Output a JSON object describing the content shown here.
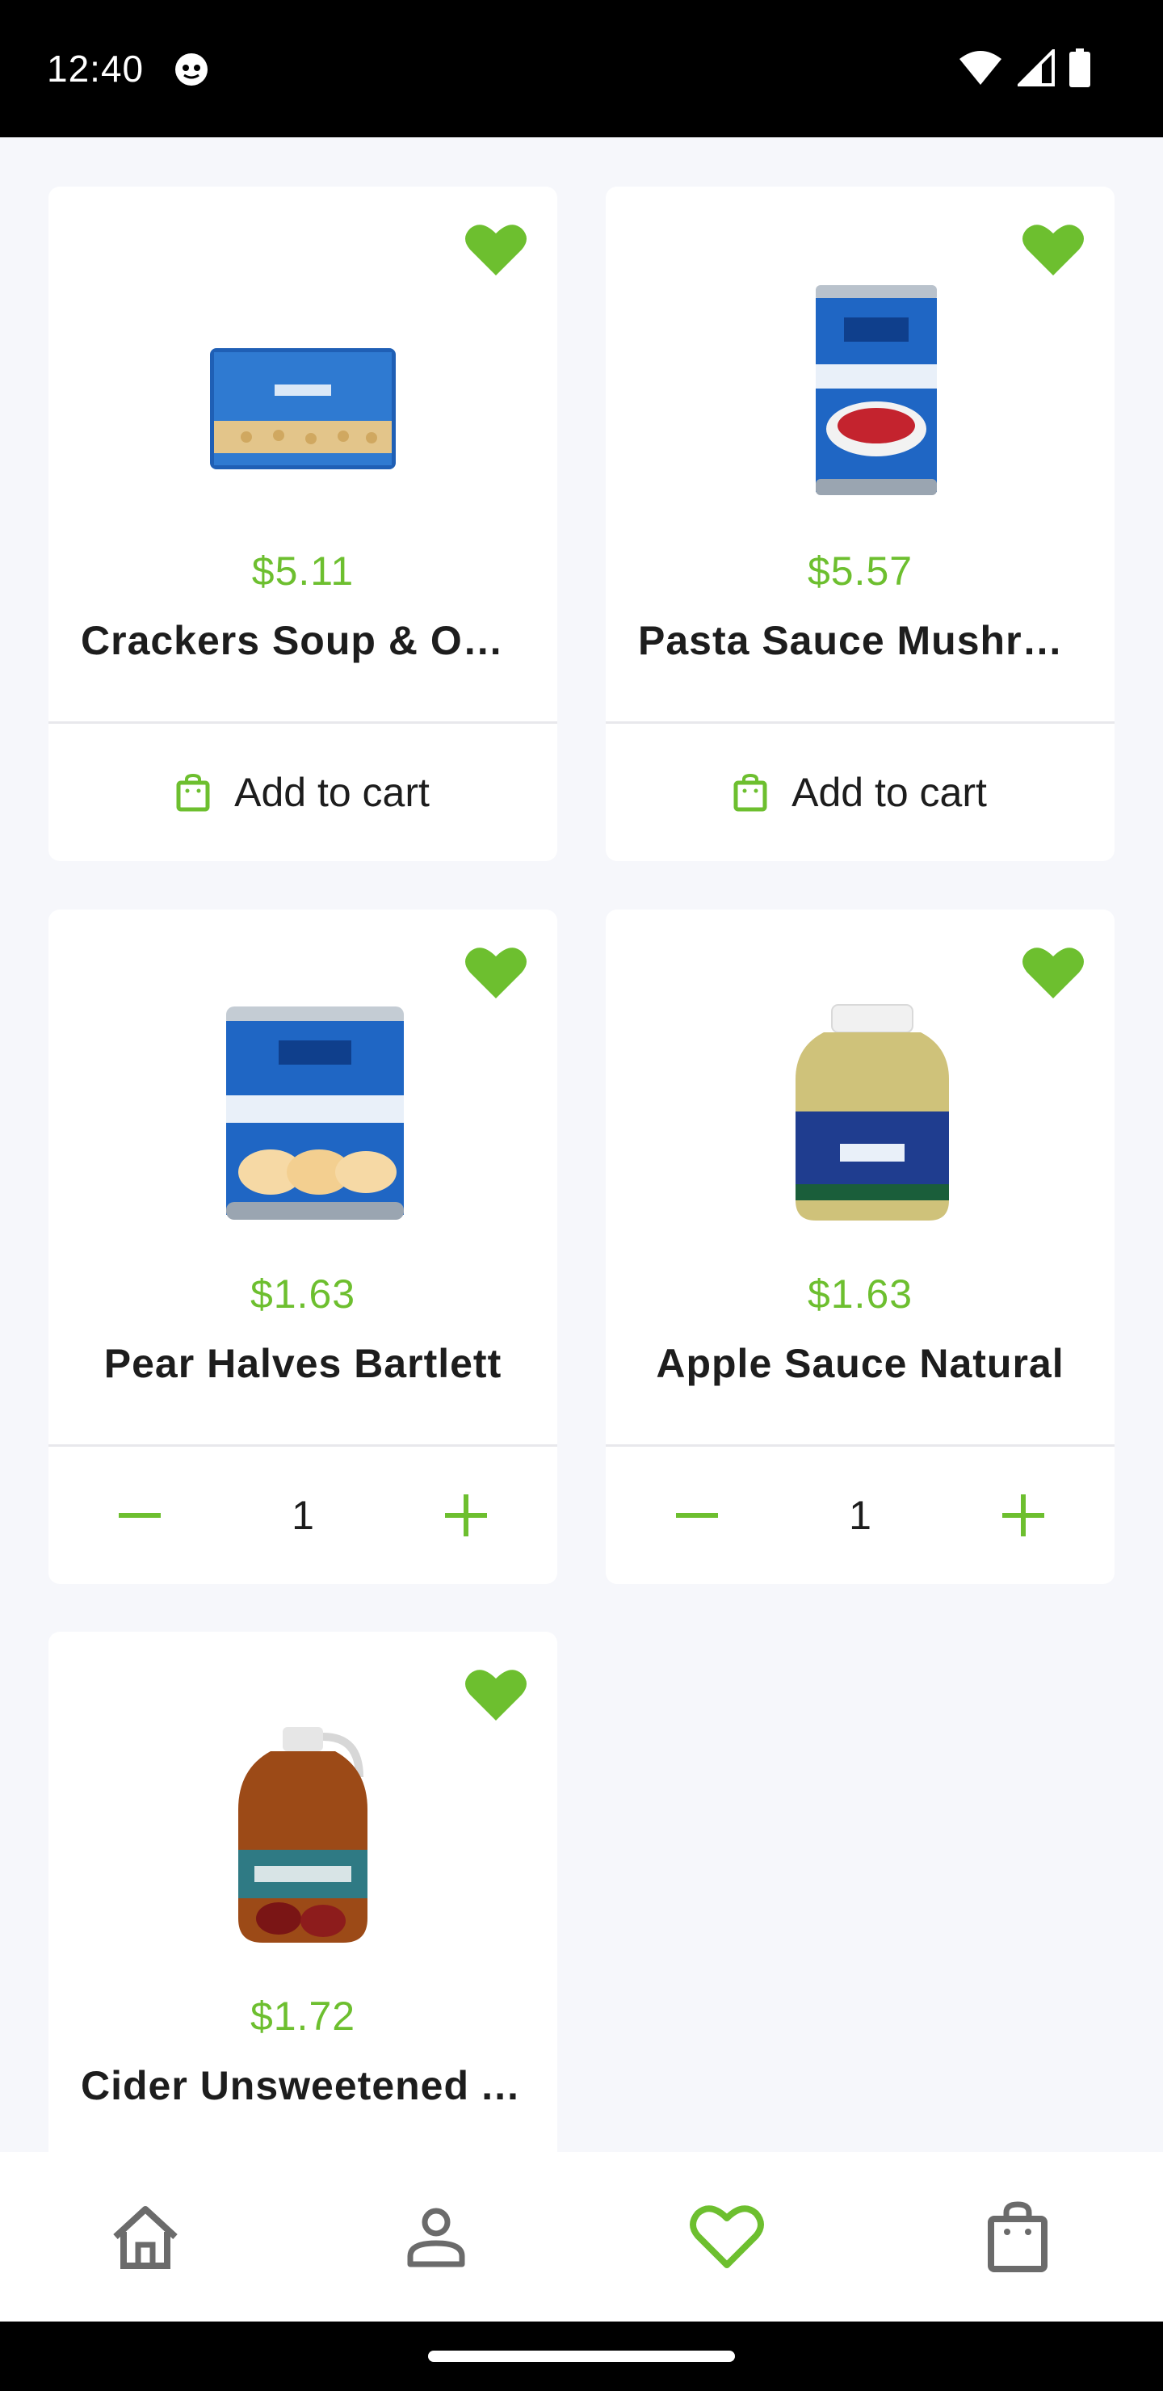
{
  "status_bar": {
    "time": "12:40"
  },
  "colors": {
    "accent": "#6dbf2f",
    "nav_inactive": "#6b6b6b",
    "background": "#f6f7fb"
  },
  "products": [
    {
      "price": "$5.11",
      "name": "Crackers Soup & Oyster",
      "favorite": true,
      "action": "add_to_cart",
      "add_label": "Add to cart",
      "image": "crackers-package"
    },
    {
      "price": "$5.57",
      "name": "Pasta Sauce Mushroom",
      "favorite": true,
      "action": "add_to_cart",
      "add_label": "Add to cart",
      "image": "pasta-sauce-can"
    },
    {
      "price": "$1.63",
      "name": "Pear Halves Bartlett",
      "favorite": true,
      "action": "stepper",
      "quantity": "1",
      "image": "pear-halves-can"
    },
    {
      "price": "$1.63",
      "name": "Apple Sauce Natural",
      "favorite": true,
      "action": "stepper",
      "quantity": "1",
      "image": "apple-sauce-jar"
    },
    {
      "price": "$1.72",
      "name": "Cider Unsweetened Apple",
      "favorite": true,
      "action": "none",
      "image": "cider-jug"
    }
  ],
  "bottom_nav": {
    "items": [
      {
        "icon": "home-icon",
        "active": false
      },
      {
        "icon": "profile-icon",
        "active": false
      },
      {
        "icon": "favorites-icon",
        "active": true
      },
      {
        "icon": "cart-bag-icon",
        "active": false
      }
    ]
  }
}
